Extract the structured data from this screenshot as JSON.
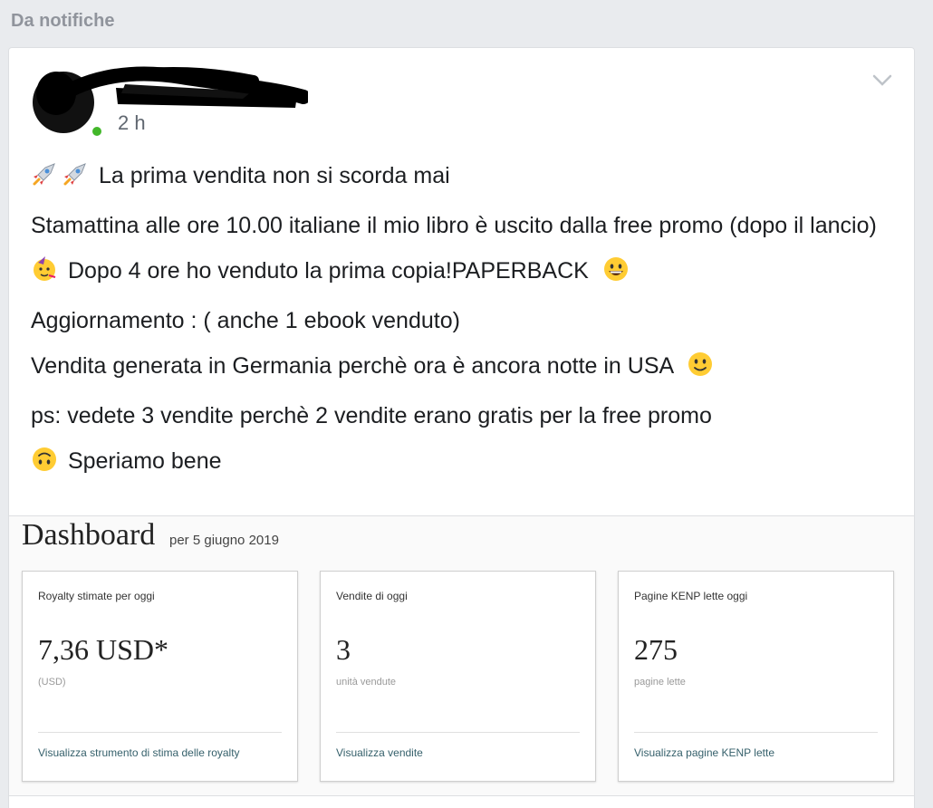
{
  "section": {
    "label": "Da notifiche"
  },
  "post": {
    "timestamp": "2 h",
    "lines": [
      "La prima vendita non si scorda mai",
      "Stamattina alle ore 10.00 italiane il mio libro è uscito dalla free promo (dopo il lancio)",
      "Dopo 4 ore ho venduto la prima copia!PAPERBACK",
      "Aggiornamento : ( anche 1 ebook venduto)",
      "Vendita generata in Germania perchè ora è ancora notte in USA",
      "ps: vedete 3 vendite perchè 2 vendite erano gratis per la free promo",
      "Speriamo bene"
    ],
    "icons": {
      "line1": "rocket-icon",
      "line3_lead": "partying-face-icon",
      "line3_trail": "grinning-face-icon",
      "line5_trail": "slightly-smiling-face-icon",
      "line7_lead": "upside-down-face-icon"
    }
  },
  "dashboard": {
    "title": "Dashboard",
    "date": "per 5 giugno 2019",
    "cards": [
      {
        "label": "Royalty stimate per oggi",
        "value": "7,36 USD*",
        "sub": "(USD)",
        "link": "Visualizza strumento di stima delle royalty"
      },
      {
        "label": "Vendite di oggi",
        "value": "3",
        "sub": "unità vendute",
        "link": "Visualizza vendite"
      },
      {
        "label": "Pagine KENP lette oggi",
        "value": "275",
        "sub": "pagine lette",
        "link": "Visualizza pagine KENP lette"
      }
    ]
  },
  "colors": {
    "online": "#42b72a",
    "link": "#35606b",
    "background": "#e9ebee"
  }
}
